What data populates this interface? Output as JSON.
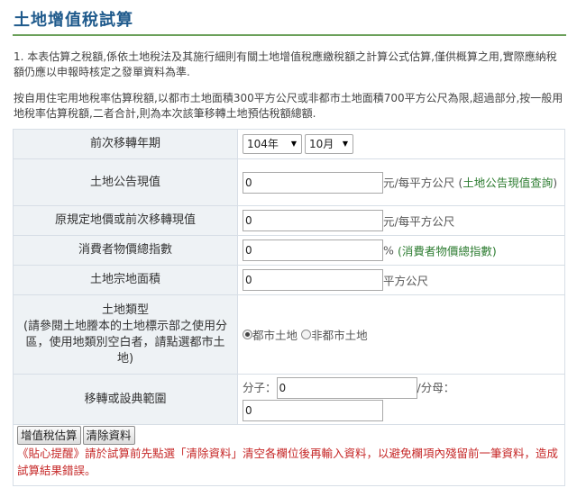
{
  "page": {
    "title": "土地增值稅試算",
    "note1": "1. 本表估算之稅額,係依土地稅法及其施行細則有關土地增值稅應繳稅額之計算公式估算,僅供概算之用,實際應納稅額仍應以申報時核定之發單資料為準.",
    "note2": "按自用住宅用地稅率估算稅額,以都市土地面積300平方公尺或非都市土地面積700平方公尺為限,超過部分,按一般用地稅率估算稅額,二者合計,則為本次該筆移轉土地預估稅額總額."
  },
  "form": {
    "prev_transfer": {
      "label": "前次移轉年期",
      "year": "104年",
      "month": "10月"
    },
    "announced_value": {
      "label": "土地公告現值",
      "value": "0",
      "unit": "元/每平方公尺",
      "link_open": "(",
      "link": "土地公告現值查詢",
      "link_close": ")"
    },
    "original_value": {
      "label": "原規定地價或前次移轉現值",
      "value": "0",
      "unit": "元/每平方公尺"
    },
    "cpi": {
      "label": "消費者物價總指數",
      "value": "0",
      "unit": "%",
      "link": "(消費者物價總指數)"
    },
    "area": {
      "label": "土地宗地面積",
      "value": "0",
      "unit": "平方公尺"
    },
    "land_type": {
      "label_line1": "土地類型",
      "label_line2": "(請參閱土地謄本的土地標示部之使用分區，使用地類別空白者，請點選都市土地)",
      "option_urban": "都市土地",
      "option_nonurban": "非都市土地",
      "selected": "都市土地"
    },
    "transfer_scope": {
      "label": "移轉或設典範圍",
      "numerator_label": "分子：",
      "numerator": "0",
      "denominator_label": "/分母：",
      "denominator": "0"
    }
  },
  "buttons": {
    "estimate": "增值稅估算",
    "clear": "清除資料"
  },
  "tip": "《貼心提醒》請於試算前先點選「清除資料」清空各欄位後再輸入資料，以避免欄項內殘留前一筆資料，造成試算結果錯誤。",
  "colors": {
    "title": "#1f5a8c",
    "rule": "#6ba05a",
    "label_bg": "#eef2f5",
    "link": "#2e7d32",
    "tip": "#c62828"
  },
  "icons": {
    "dropdown": "triangle-down",
    "radio": "radio-circle"
  }
}
